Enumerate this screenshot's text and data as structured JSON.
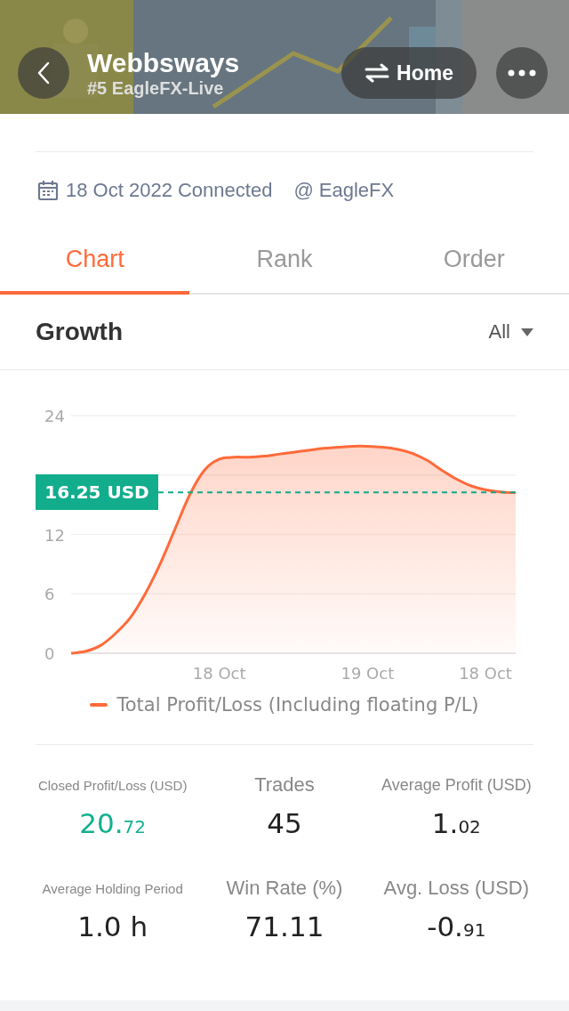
{
  "header": {
    "title": "Webbsways",
    "subtitle": "#5 EagleFX-Live",
    "switch_button": "Home"
  },
  "info": {
    "connected": "18 Oct 2022 Connected",
    "broker": "EagleFX",
    "broker_prefix": "@"
  },
  "tabs": [
    {
      "label": "Chart",
      "selected": true
    },
    {
      "label": "Rank",
      "selected": false
    },
    {
      "label": "Order",
      "selected": false
    }
  ],
  "section": {
    "title": "Growth",
    "filter": "All"
  },
  "chart_data": {
    "type": "area",
    "categories": [
      null,
      null,
      null,
      null,
      null,
      null,
      null,
      null,
      null,
      null,
      "18 Oct",
      null,
      null,
      null,
      null,
      null,
      null,
      null,
      null,
      null,
      "19 Oct",
      null,
      null,
      null,
      null,
      null,
      null,
      null,
      "18 Oct",
      null,
      null
    ],
    "series": [
      {
        "name": "Total Profit/Loss (Including floating P/L)",
        "color": "#ff6a3a",
        "values": [
          0,
          0.2,
          0.8,
          2,
          3.6,
          6,
          9,
          12.5,
          16,
          18.5,
          19.6,
          19.8,
          19.8,
          19.9,
          20.1,
          20.3,
          20.5,
          20.7,
          20.8,
          20.9,
          20.9,
          20.8,
          20.6,
          20.2,
          19.5,
          18.5,
          17.6,
          16.9,
          16.5,
          16.3,
          16.2
        ]
      }
    ],
    "ylim": [
      0,
      24
    ],
    "yticks": [
      0,
      6,
      12,
      24
    ],
    "grid": true,
    "ref_lines": [
      {
        "axis": "y",
        "value": 16.25,
        "label": "16.25 USD",
        "color": "#12a88a"
      }
    ]
  },
  "stats": [
    {
      "label": "Closed Profit/Loss (USD)",
      "kind": "small",
      "integer": "20.",
      "decimal": "72",
      "color": "#12b08f"
    },
    {
      "label": "Trades",
      "kind": "large",
      "integer": "45",
      "color": "#222222"
    },
    {
      "label": "Average Profit (USD)",
      "kind": "medium",
      "integer": "1.",
      "decimal": "02",
      "color": "#222222"
    },
    {
      "label": "Average Holding Period",
      "kind": "small",
      "integer": "1.0 h",
      "color": "#222222"
    },
    {
      "label": "Win Rate (%)",
      "kind": "large",
      "integer": "71.11",
      "color": "#222222"
    },
    {
      "label": "Avg. Loss (USD)",
      "kind": "large",
      "integer": "-0.",
      "decimal": "91",
      "color": "#222222"
    }
  ]
}
